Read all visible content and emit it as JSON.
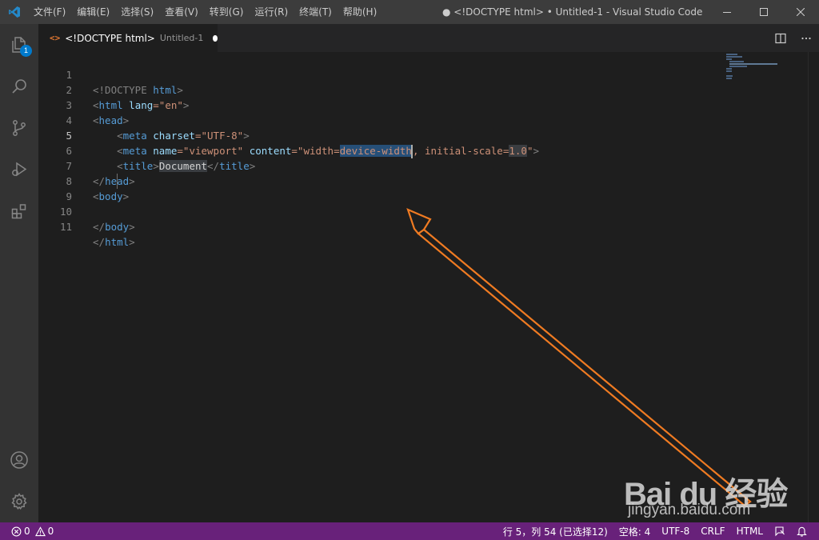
{
  "window": {
    "title": "● <!DOCTYPE html> • Untitled-1 - Visual Studio Code",
    "menu": [
      "文件(F)",
      "编辑(E)",
      "选择(S)",
      "查看(V)",
      "转到(G)",
      "运行(R)",
      "终端(T)",
      "帮助(H)"
    ],
    "controls": [
      "minimize-icon",
      "maximize-icon",
      "close-icon"
    ]
  },
  "activity_bar": {
    "items": [
      {
        "icon": "explorer-icon",
        "badge": "1"
      },
      {
        "icon": "search-icon"
      },
      {
        "icon": "source-control-icon"
      },
      {
        "icon": "run-debug-icon"
      },
      {
        "icon": "extensions-icon"
      }
    ],
    "bottom": [
      {
        "icon": "account-icon"
      },
      {
        "icon": "settings-gear-icon"
      }
    ]
  },
  "tab": {
    "icon": "<>",
    "name": "<!DOCTYPE html>",
    "description": "Untitled-1",
    "dirty": true
  },
  "editor": {
    "lines": [
      "1",
      "2",
      "3",
      "4",
      "5",
      "6",
      "7",
      "8",
      "9",
      "10",
      "11"
    ],
    "active_line": 5,
    "code": {
      "l1": {
        "a": "<!DOCTYPE ",
        "b": "html",
        "c": ">"
      },
      "l2": {
        "a": "<",
        "b": "html",
        "c": "lang",
        "d": "=\"en\"",
        "e": ">"
      },
      "l3": {
        "a": "<",
        "b": "head",
        "c": ">"
      },
      "l4": {
        "a": "<",
        "b": "meta",
        "c": "charset",
        "d": "=\"UTF-8\"",
        "e": ">"
      },
      "l5": {
        "a": "<",
        "b": "meta",
        "c": "name",
        "d": "=\"viewport\"",
        "e": "content",
        "f": "=\"width=",
        "g": "device-width",
        "h": ", initial-scale=",
        "i": "1.0",
        "j": "\"",
        "k": ">"
      },
      "l6": {
        "a": "<",
        "b": "title",
        "c": ">",
        "d": "Document",
        "e": "</",
        "f": "title",
        "g": ">"
      },
      "l7": {
        "a": "</",
        "b": "head",
        "c": ">"
      },
      "l8": {
        "a": "<",
        "b": "body",
        "c": ">"
      },
      "l10": {
        "a": "</",
        "b": "body",
        "c": ">"
      },
      "l11": {
        "a": "</",
        "b": "html",
        "c": ">"
      }
    }
  },
  "annotation": {
    "color": "#f07b22"
  },
  "watermark": {
    "logo": "Bai du 经验",
    "url": "jingyan.baidu.com"
  },
  "status_bar": {
    "errors": "0",
    "warnings": "0",
    "position": "行 5，列 54 (已选择12)",
    "indent": "空格: 4",
    "encoding": "UTF-8",
    "eol": "CRLF",
    "language": "HTML",
    "feedback_icon": "feedback-icon",
    "notifications_icon": "bell-icon"
  },
  "colors": {
    "status_bar": "#68217a",
    "accent": "#007acc",
    "selection": "#264f78"
  }
}
